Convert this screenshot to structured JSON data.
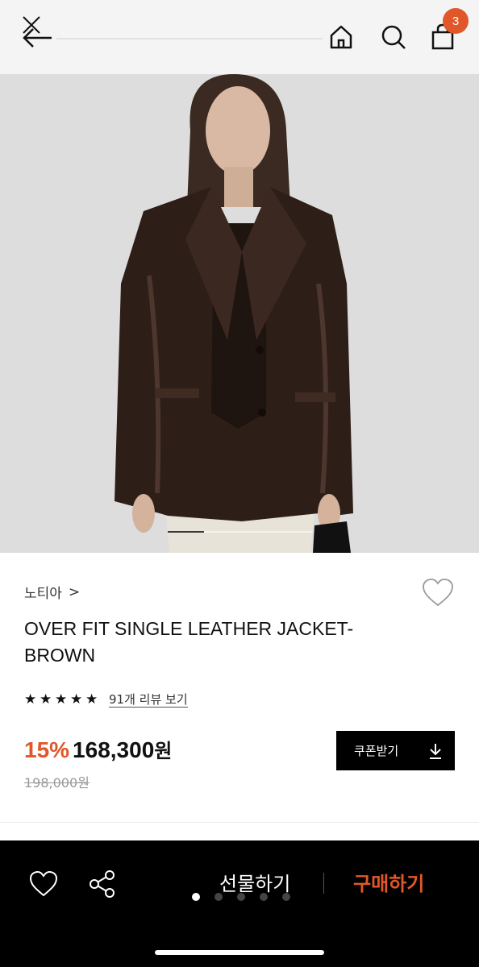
{
  "header": {
    "close_icon": "close-icon",
    "back_icon": "arrow-left-icon",
    "home_icon": "home-icon",
    "search_icon": "search-icon",
    "cart_icon": "shopping-bag-icon",
    "cart_count": "3"
  },
  "product": {
    "image_slide": {
      "current": 1,
      "total": 4
    },
    "brand": "노티아",
    "brand_chevron": ">",
    "title": "OVER FIT SINGLE LEATHER JACKET-BROWN",
    "rating_stars": 5,
    "review_link": "91개 리뷰 보기",
    "discount": "15%",
    "price": "168,300",
    "price_unit": "원",
    "original_price": "198,000원",
    "coupon_label": "쿠폰받기",
    "wish_icon": "heart-outline-icon"
  },
  "bottom_bar": {
    "gift_label": "선물하기",
    "buy_label": "구매하기",
    "pager": {
      "current": 1,
      "total": 5
    }
  },
  "colors": {
    "accent": "#e0582a",
    "bar_bg": "#000000",
    "header_bg": "#f4f4f4"
  }
}
